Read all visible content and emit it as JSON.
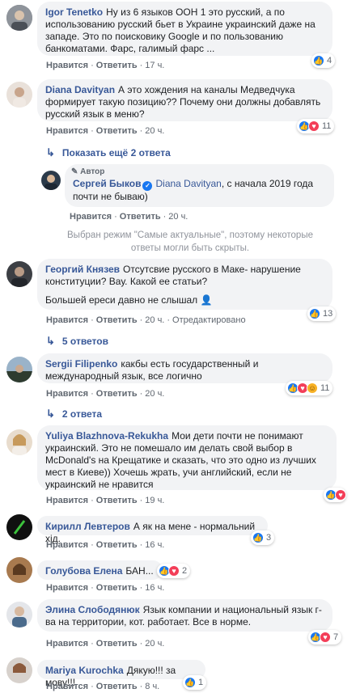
{
  "actions": {
    "like": "Нравится",
    "reply": "Ответить",
    "unmoderate": "Отредактировано"
  },
  "comments": [
    {
      "author": "Igor Tenetko",
      "text": "Ну из 6 языков ООН 1 это русский, а по использованию русский бьет в Украине украинский даже на западе. Это по поисковику Google и по пользованию банкоматами. Фарс, галимый фарс ...",
      "time": "17 ч.",
      "reactions": "4"
    },
    {
      "author": "Diana Davityan",
      "text": "А это хождения на каналы Медведчука формирует такую позицию?? Почему они должны добавлять русский язык в меню?",
      "time": "20 ч.",
      "reactions": "11"
    },
    {
      "author": "Георгий Князев",
      "text": "Отсутсвие русского в Маке- нарушение конституции? Вау. Какой ее статьи?",
      "text2": "Большей ереси давно не слышал",
      "time": "20 ч.",
      "reactions": "13"
    },
    {
      "author": "Sergii Filipenko",
      "text": "какбы есть государственный и международный язык, все логично",
      "time": "20 ч.",
      "reactions": "11"
    },
    {
      "author": "Yuliya Blazhnova-Rekukha",
      "text": "Мои дети почти не понимают украинский. Это не помешало им делать свой выбор в McDonald's на Крещатике и сказать, что это одно из лучших мест в Киеве)) Хочешь жрать, учи английский, если не украинский не нравится",
      "time": "19 ч.",
      "reactions": ""
    },
    {
      "author": "Кирилл Левтеров",
      "text": "А як на мене - нормальний хід.",
      "time": "16 ч.",
      "reactions": "3"
    },
    {
      "author": "Голубова Елена",
      "text": "БАН...",
      "time": "16 ч.",
      "reactions": "2"
    },
    {
      "author": "Элина Слободянюк",
      "text": "Язык компании и национальный язык г-ва на территории, кот. работает. Все в норме.",
      "time": "20 ч.",
      "reactions": "7"
    },
    {
      "author": "Mariya Kurochka",
      "text": "Дякую!!! за мову!!!",
      "time": "8 ч.",
      "reactions": "1"
    }
  ],
  "reply": {
    "badge": "Автор",
    "author": "Сергей Быков",
    "mention": "Diana Davityan",
    "text": ", с начала 2019 года почти не бываю)",
    "time": "20 ч."
  },
  "links": {
    "show_more": "Показать ещё 2 ответа",
    "replies_5": "5 ответов",
    "replies_2": "2 ответа"
  },
  "notice": "Выбран режим \"Самые актуальные\", поэтому некоторые ответы могли быть скрыты.",
  "colors": {
    "link": "#385898",
    "bubble": "#f2f3f5",
    "like": "#1877f2",
    "love": "#f33e58"
  }
}
